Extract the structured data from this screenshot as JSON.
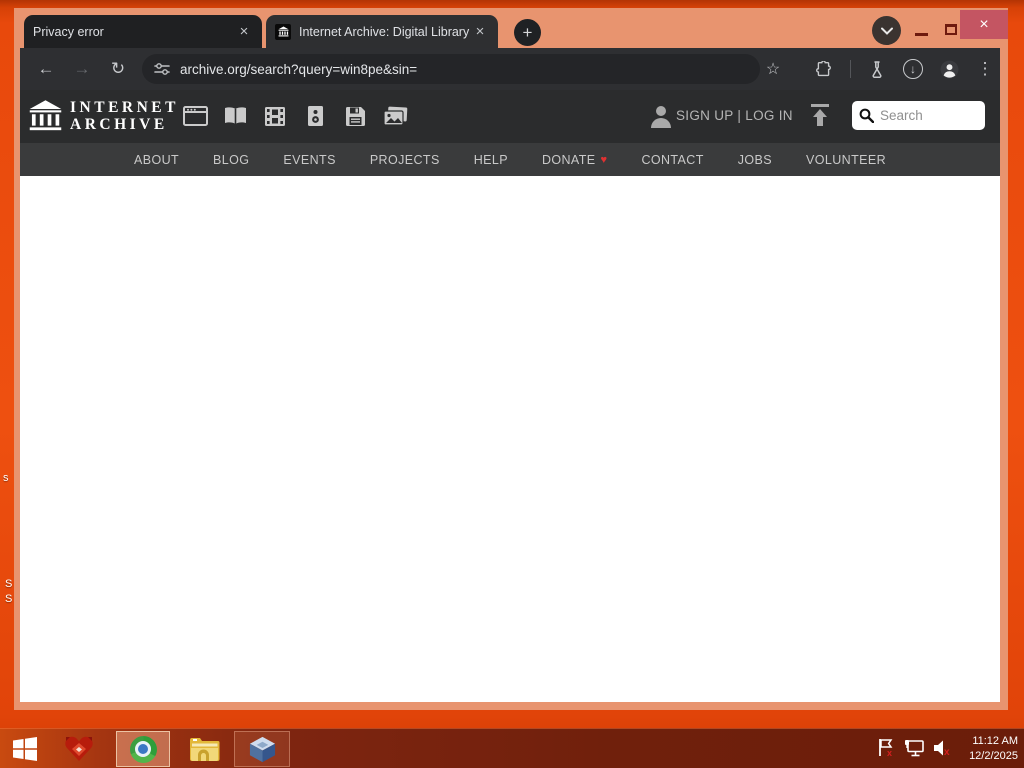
{
  "browser": {
    "tabs": [
      {
        "title": "Privacy error"
      },
      {
        "title": "Internet Archive: Digital Library"
      }
    ],
    "url": "archive.org/search?query=win8pe&sin="
  },
  "archive": {
    "logo_line1": "INTERNET",
    "logo_line2": "ARCHIVE",
    "media_types": [
      "web",
      "texts",
      "video",
      "audio",
      "software",
      "images"
    ],
    "auth": "SIGN UP | LOG IN",
    "search_placeholder": "Search",
    "nav": [
      "ABOUT",
      "BLOG",
      "EVENTS",
      "PROJECTS",
      "HELP",
      "DONATE",
      "CONTACT",
      "JOBS",
      "VOLUNTEER"
    ]
  },
  "desktop": {
    "fragments": [
      "s",
      "S",
      "S"
    ]
  },
  "taskbar": {
    "time": "11:12 AM",
    "date": "12/2/2025"
  },
  "icons": {
    "close": "×",
    "plus": "+",
    "kebab": "⋮",
    "star": "☆",
    "back": "←",
    "forward": "→",
    "reload": "↻",
    "down": "↓",
    "heart": "♥"
  },
  "colors": {
    "desktop_orange": "#e8490c",
    "frame_salmon": "#e8946f",
    "toolbar_dark": "#2e2f32",
    "ia_header": "#2b2c2d",
    "ia_nav": "#3a3b3c",
    "taskbar_red": "#7e2510",
    "close_button": "#c45562",
    "donate_heart": "#e03131"
  }
}
